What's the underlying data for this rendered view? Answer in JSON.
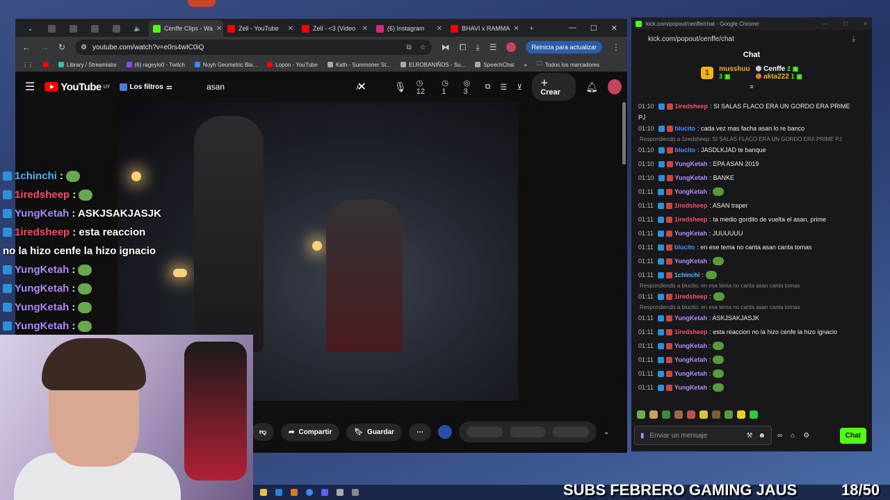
{
  "browser": {
    "tabs": [
      {
        "label": "Cenffe Clips - Wa",
        "color": "#53fc18",
        "active": true
      },
      {
        "label": "Zell - YouTube",
        "color": "#ff0000"
      },
      {
        "label": "Zell - <3 (Video",
        "color": "#ff0000"
      },
      {
        "label": "(6) Instagram",
        "color": "#d62976"
      },
      {
        "label": "BHAVI x RAMMA",
        "color": "#ff0000"
      }
    ],
    "url": "youtube.com/watch?v=e0rs4wIC0iQ",
    "update_label": "Reinicia para actualizar",
    "bookmarks": [
      "Library / Streamlabs",
      "(6) rageylo0 - Twitch",
      "Noyh Geometric Bla...",
      "Lopon - YouTube",
      "Kath - Summoner St...",
      "ELROBANIÑOS - Su...",
      "SpeechChat",
      "Todos los marcadores"
    ]
  },
  "youtube": {
    "logo": "YouTube",
    "region": "UY",
    "filters_label": "Los filtros",
    "search_value": "asan",
    "ext_counts": [
      "12",
      "1",
      "3"
    ],
    "create_label": "Crear",
    "actions": {
      "share": "Compartir",
      "save": "Guardar"
    }
  },
  "overlay_chat": [
    {
      "user": "1chinchi",
      "color": "blue",
      "text": ":"
    },
    {
      "user": "1iredsheep",
      "color": "red",
      "text": ":"
    },
    {
      "user": "YungKetah",
      "color": "purple",
      "text": ": ASKJSAKJASJK"
    },
    {
      "user": "1iredsheep",
      "color": "red",
      "text": ": esta reaccion"
    },
    {
      "user": "",
      "color": "purple",
      "text": "no la hizo cenfe la hizo ignacio"
    },
    {
      "user": "YungKetah",
      "color": "purple",
      "text": ":"
    },
    {
      "user": "YungKetah",
      "color": "purple",
      "text": ":"
    },
    {
      "user": "YungKetah",
      "color": "purple",
      "text": ":"
    },
    {
      "user": "YungKetah",
      "color": "purple",
      "text": ":"
    }
  ],
  "kick": {
    "window_title": "kick.com/popout/cenffe/chat - Google Chrome",
    "url": "kick.com/popout/cenffe/chat",
    "header": "Chat",
    "leaderboard": {
      "first": {
        "rank": "1",
        "name": "musshuu",
        "count": "3"
      },
      "second": {
        "name": "Cenffe",
        "count": "2"
      },
      "third": {
        "name": "akta222",
        "count": "1"
      }
    },
    "messages": [
      {
        "type": "msg",
        "time": "01:10",
        "user": "1iredsheep",
        "color": "#ff4d6d",
        "text": ": SI SALAS FLACO ERA UN GORDO ERA PRIME"
      },
      {
        "type": "cont",
        "text": "PJ"
      },
      {
        "type": "msg",
        "time": "01:10",
        "user": "blucito",
        "color": "#4a8cff",
        "text": ": cada vez mas facha asan lo re banco"
      },
      {
        "type": "reply",
        "text": "Respondiendo a 1iredsheep: SI SALAS FLACO ERA UN GORDO ERA PRIME PJ"
      },
      {
        "type": "msg",
        "time": "01:10",
        "user": "blucito",
        "color": "#4a8cff",
        "text": ": JASDLKJAD te banque"
      },
      {
        "type": "msg",
        "time": "01:10",
        "user": "YungKetah",
        "color": "#b18cff",
        "text": ": EPA ASAN 2019"
      },
      {
        "type": "msg",
        "time": "01:10",
        "user": "YungKetah",
        "color": "#b18cff",
        "text": ": BANKE"
      },
      {
        "type": "msg",
        "time": "01:11",
        "user": "YungKetah",
        "color": "#b18cff",
        "text": ":",
        "emote": true
      },
      {
        "type": "msg",
        "time": "01:11",
        "user": "1iredsheep",
        "color": "#ff4d6d",
        "text": ": ASAN traper"
      },
      {
        "type": "msg",
        "time": "01:11",
        "user": "1iredsheep",
        "color": "#ff4d6d",
        "text": ": ta medio gordito de vuelta el asan, prime"
      },
      {
        "type": "msg",
        "time": "01:11",
        "user": "YungKetah",
        "color": "#b18cff",
        "text": ": JUUUUUU"
      },
      {
        "type": "msg",
        "time": "01:11",
        "user": "blucito",
        "color": "#4a8cff",
        "text": ": en ese tema no canta asan canta tomas"
      },
      {
        "type": "msg",
        "time": "01:11",
        "user": "YungKetah",
        "color": "#b18cff",
        "text": ":",
        "emote": true
      },
      {
        "type": "msg",
        "time": "01:11",
        "user": "1chinchi",
        "color": "#4fb8ff",
        "text": ":",
        "emote": true
      },
      {
        "type": "reply",
        "text": "Respondiendo a blucito: en ese tema no canta asan canta tomas"
      },
      {
        "type": "msg",
        "time": "01:11",
        "user": "1iredsheep",
        "color": "#ff4d6d",
        "text": ":",
        "emote": true
      },
      {
        "type": "reply",
        "text": "Respondiendo a blucito: en ese tema no canta asan canta tomas"
      },
      {
        "type": "msg",
        "time": "01:11",
        "user": "YungKetah",
        "color": "#b18cff",
        "text": ": ASKJSAKJASJK"
      },
      {
        "type": "msg",
        "time": "01:11",
        "user": "1iredsheep",
        "color": "#ff4d6d",
        "text": ": esta reaccion no la hizo cenfe la hizo ignacio"
      },
      {
        "type": "msg",
        "time": "01:11",
        "user": "YungKetah",
        "color": "#b18cff",
        "text": ":",
        "emote": true
      },
      {
        "type": "msg",
        "time": "01:11",
        "user": "YungKetah",
        "color": "#b18cff",
        "text": ":",
        "emote": true
      },
      {
        "type": "msg",
        "time": "01:11",
        "user": "YungKetah",
        "color": "#b18cff",
        "text": ":",
        "emote": true
      },
      {
        "type": "msg",
        "time": "01:11",
        "user": "YungKetah",
        "color": "#b18cff",
        "text": ":",
        "emote": true
      }
    ],
    "input_placeholder": "Enviar un mensaje",
    "send_label": "Chat"
  },
  "stream_overlay": {
    "subs_text": "SUBS FEBRERO GAMING JAUS",
    "subs_count": "18/50"
  }
}
